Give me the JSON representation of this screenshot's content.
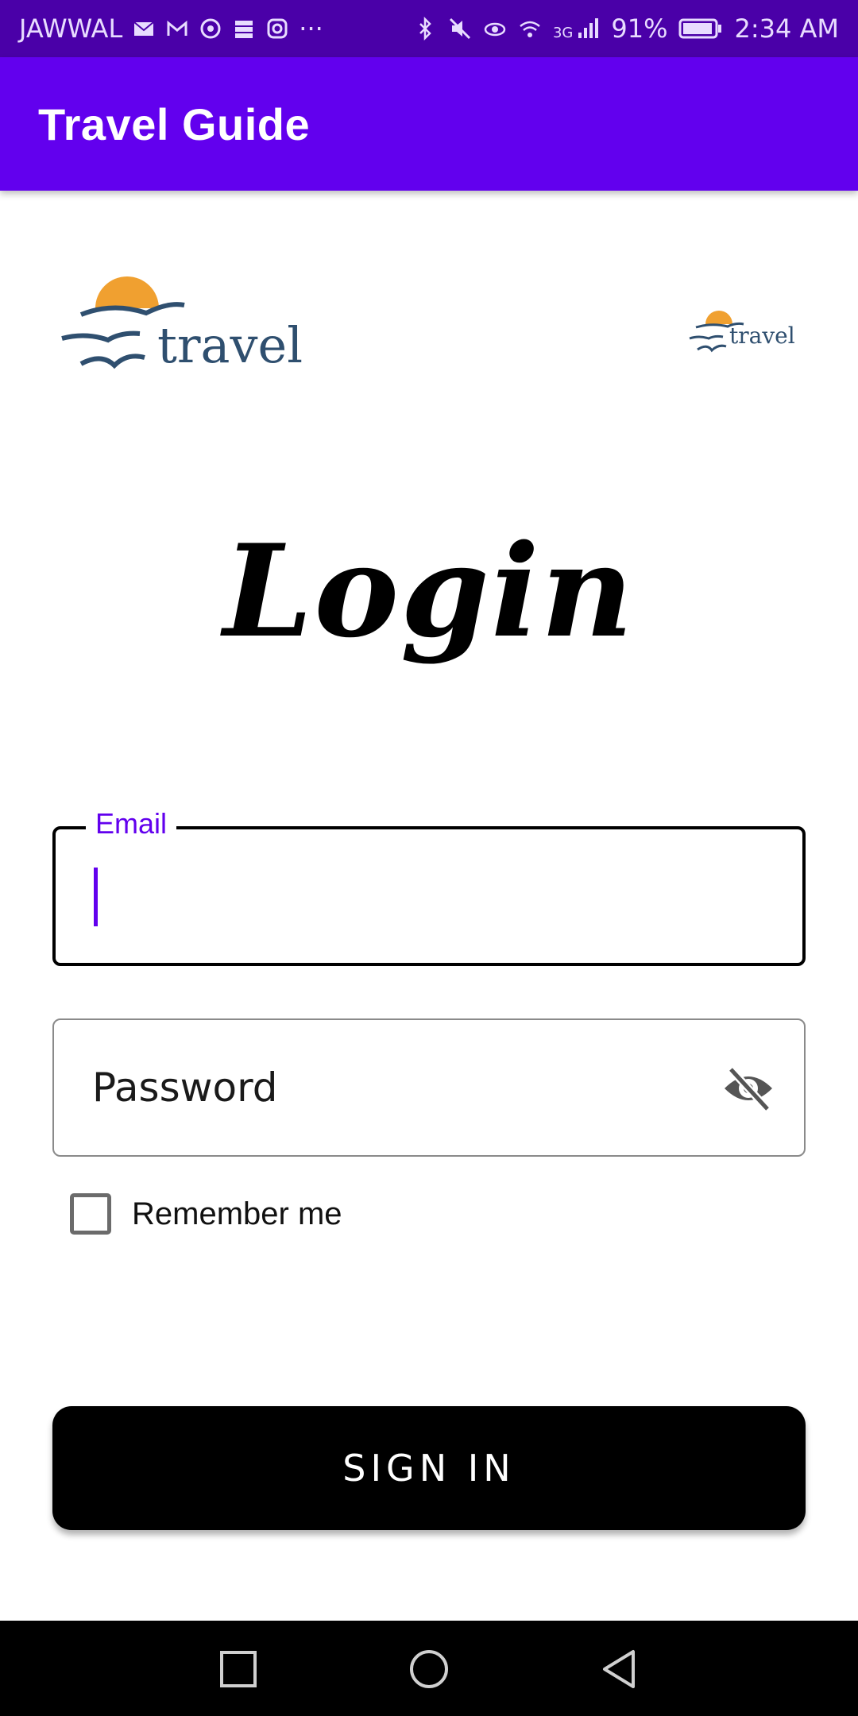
{
  "status_bar": {
    "carrier": "JAWWAL",
    "more": "···",
    "network": "3G",
    "battery": "91%",
    "time": "2:34 AM",
    "icons_left": [
      "mail-icon",
      "gmail-icon",
      "whatsapp-icon",
      "storage-icon",
      "instagram-icon"
    ],
    "icons_right": [
      "bluetooth-icon",
      "mute-icon",
      "eye-comfort-icon",
      "wifi-icon",
      "signal-icon",
      "battery-icon"
    ]
  },
  "app_bar": {
    "title": "Travel Guide"
  },
  "logos": {
    "large_text": "travel",
    "small_text": "travel"
  },
  "login": {
    "heading": "Login"
  },
  "email": {
    "label": "Email",
    "value": ""
  },
  "password": {
    "placeholder": "Password",
    "toggle_icon": "visibility-off-icon"
  },
  "remember": {
    "label": "Remember me",
    "checked": false
  },
  "signin": {
    "label": "SIGN IN"
  },
  "nav": {
    "buttons": [
      "recents-square-icon",
      "home-circle-icon",
      "back-triangle-icon"
    ]
  },
  "colors": {
    "status_bar": "#4a00a8",
    "primary": "#6200ee",
    "logo_text": "#2f4f6f",
    "logo_sun": "#f0a030",
    "button": "#000000"
  }
}
